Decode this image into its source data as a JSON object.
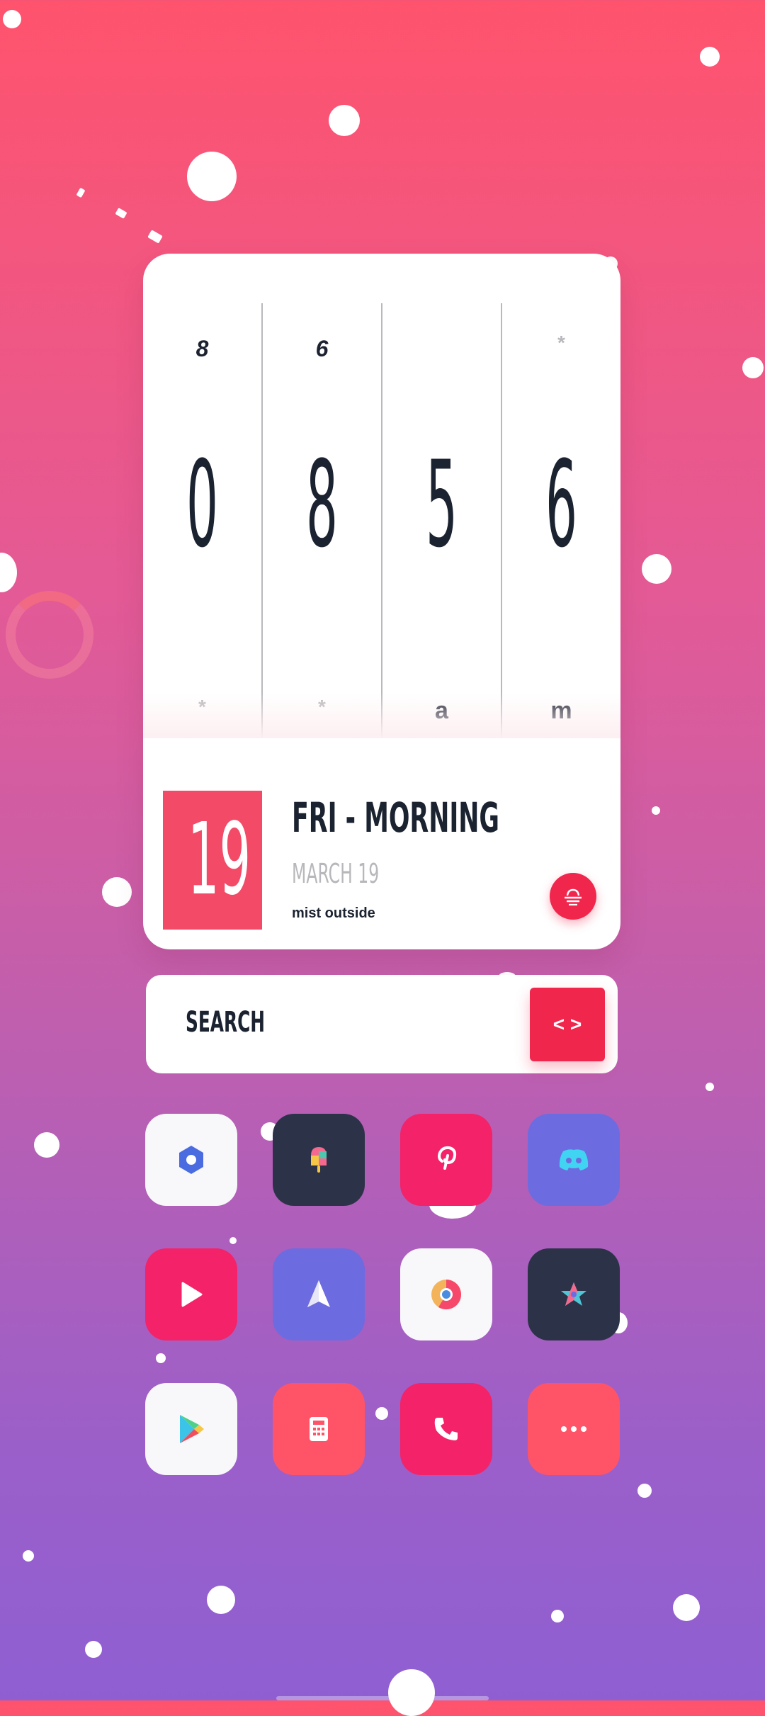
{
  "clock": {
    "columns": [
      {
        "top": "8",
        "digit": "0",
        "bottom": "*"
      },
      {
        "top": "6",
        "digit": "8",
        "bottom": "*"
      },
      {
        "top": "",
        "digit": "5",
        "bottom": "a"
      },
      {
        "top": "*",
        "digit": "6",
        "bottom": "m"
      }
    ]
  },
  "date": {
    "day_number": "19",
    "title": "FRI - MORNING",
    "month_line": "MARCH 19",
    "weather": "mist outside"
  },
  "search": {
    "label": "SEARCH",
    "button_glyph": "< >"
  },
  "apps": [
    {
      "name": "settings",
      "icon": "settings-gear-icon",
      "bg": "#f8f8fa"
    },
    {
      "name": "popsicle",
      "icon": "popsicle-icon",
      "bg": "#2c3349"
    },
    {
      "name": "pinterest",
      "icon": "pinterest-icon",
      "bg": "#f42268"
    },
    {
      "name": "discord",
      "icon": "discord-icon",
      "bg": "#6d6be0"
    },
    {
      "name": "youtube",
      "icon": "play-icon",
      "bg": "#f42268"
    },
    {
      "name": "send",
      "icon": "paper-plane-icon",
      "bg": "#6d6be0"
    },
    {
      "name": "chrome",
      "icon": "chrome-icon",
      "bg": "#f8f8fa"
    },
    {
      "name": "starred",
      "icon": "star-icon",
      "bg": "#2c3349"
    },
    {
      "name": "play-store",
      "icon": "play-store-icon",
      "bg": "#f8f8fa"
    },
    {
      "name": "calculator",
      "icon": "calculator-icon",
      "bg": "#ff5468"
    },
    {
      "name": "phone",
      "icon": "phone-icon",
      "bg": "#f42268"
    },
    {
      "name": "more",
      "icon": "more-dots-icon",
      "bg": "#ff5468"
    }
  ],
  "colors": {
    "accent": "#f0264d",
    "date_box": "#f24a67",
    "text_dark": "#1b2230"
  }
}
